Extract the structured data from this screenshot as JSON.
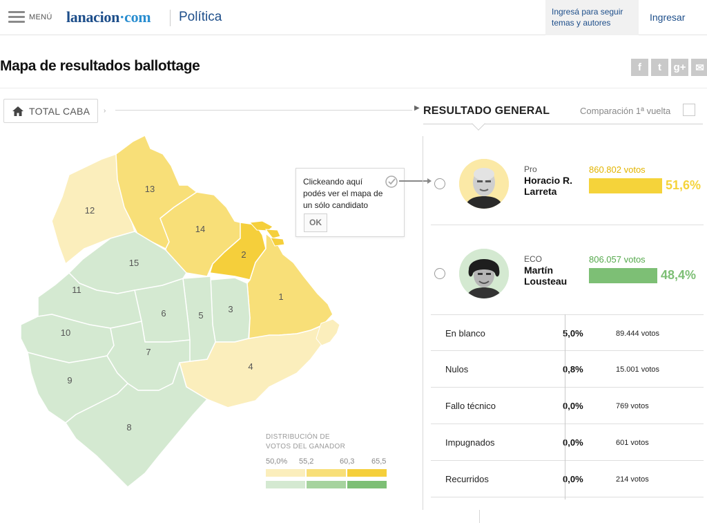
{
  "header": {
    "menu_label": "MENÚ",
    "logo_main": "lanacion",
    "logo_dot": "·",
    "logo_tld": "com",
    "section": "Política",
    "follow_text": "Ingresá para seguir temas y autores",
    "login": "Ingresar"
  },
  "page": {
    "title": "Mapa de resultados ballottage",
    "share": [
      {
        "name": "facebook-icon",
        "glyph": "f"
      },
      {
        "name": "twitter-icon",
        "glyph": "t"
      },
      {
        "name": "googleplus-icon",
        "glyph": "g+"
      },
      {
        "name": "email-icon",
        "glyph": "✉"
      }
    ]
  },
  "map": {
    "total_button": "TOTAL CABA",
    "tooltip_text": "Clickeando aquí podés ver el mapa de un sólo candidato",
    "tooltip_ok": "OK",
    "communes": [
      {
        "id": "1",
        "winner": "Pro",
        "shade": 2
      },
      {
        "id": "2",
        "winner": "Pro",
        "shade": 3
      },
      {
        "id": "3",
        "winner": "ECO",
        "shade": 1
      },
      {
        "id": "4",
        "winner": "Pro",
        "shade": 1
      },
      {
        "id": "5",
        "winner": "ECO",
        "shade": 1
      },
      {
        "id": "6",
        "winner": "ECO",
        "shade": 1
      },
      {
        "id": "7",
        "winner": "ECO",
        "shade": 1
      },
      {
        "id": "8",
        "winner": "ECO",
        "shade": 1
      },
      {
        "id": "9",
        "winner": "ECO",
        "shade": 1
      },
      {
        "id": "10",
        "winner": "ECO",
        "shade": 1
      },
      {
        "id": "11",
        "winner": "ECO",
        "shade": 1
      },
      {
        "id": "12",
        "winner": "Pro",
        "shade": 1
      },
      {
        "id": "13",
        "winner": "Pro",
        "shade": 2
      },
      {
        "id": "14",
        "winner": "Pro",
        "shade": 2
      },
      {
        "id": "15",
        "winner": "ECO",
        "shade": 1
      }
    ],
    "legend": {
      "title_line1": "DISTRIBUCIÓN DE",
      "title_line2": "VOTOS DEL GANADOR",
      "ticks": [
        "50,0%",
        "55,2",
        "60,3",
        "65,5"
      ],
      "yellow_scale": [
        "#fbeebc",
        "#f8df78",
        "#f5cf3b"
      ],
      "green_scale": [
        "#d4e9d1",
        "#a6d39e",
        "#7dbf75"
      ]
    }
  },
  "results": {
    "title": "RESULTADO GENERAL",
    "compare_label": "Comparación 1ª vuelta",
    "candidates": [
      {
        "party": "Pro",
        "name_line1": "Horacio R.",
        "name_line2": "Larreta",
        "votes": "860.802 votos",
        "percent": "51,6%",
        "share": 0.516,
        "color": "#f5d33a"
      },
      {
        "party": "ECO",
        "name_line1": "Martín",
        "name_line2": "Lousteau",
        "votes": "806.057 votos",
        "percent": "48,4%",
        "share": 0.484,
        "color": "#7dbf75"
      }
    ],
    "others": [
      {
        "label": "En blanco",
        "percent": "5,0%",
        "votes": "89.444 votos"
      },
      {
        "label": "Nulos",
        "percent": "0,8%",
        "votes": "15.001 votos"
      },
      {
        "label": "Fallo técnico",
        "percent": "0,0%",
        "votes": "769 votos"
      },
      {
        "label": "Impugnados",
        "percent": "0,0%",
        "votes": "601 votos"
      },
      {
        "label": "Recurridos",
        "percent": "0,0%",
        "votes": "214 votos"
      }
    ]
  }
}
